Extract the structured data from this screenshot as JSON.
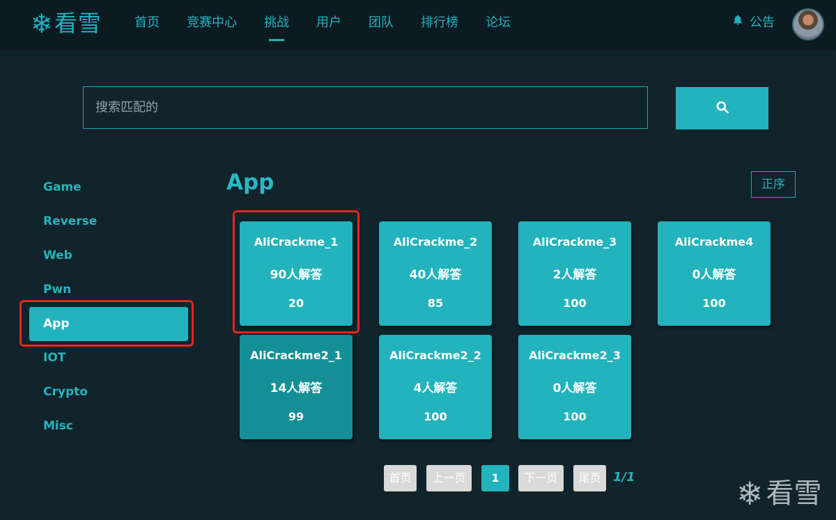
{
  "header": {
    "logo_icon": "snowflake-icon",
    "logo_glyph": "❄",
    "logo_text": "看雪",
    "nav": [
      {
        "label": "首页",
        "active": false
      },
      {
        "label": "竞赛中心",
        "active": false
      },
      {
        "label": "挑战",
        "active": true
      },
      {
        "label": "用户",
        "active": false
      },
      {
        "label": "团队",
        "active": false
      },
      {
        "label": "排行榜",
        "active": false
      },
      {
        "label": "论坛",
        "active": false
      }
    ],
    "notice_icon": "bell-icon",
    "notice_label": "公告"
  },
  "search": {
    "placeholder": "搜索匹配的",
    "button_icon": "search-icon"
  },
  "sidebar": {
    "items": [
      {
        "label": "Game",
        "active": false
      },
      {
        "label": "Reverse",
        "active": false
      },
      {
        "label": "Web",
        "active": false
      },
      {
        "label": "Pwn",
        "active": false
      },
      {
        "label": "App",
        "active": true
      },
      {
        "label": "IOT",
        "active": false
      },
      {
        "label": "Crypto",
        "active": false
      },
      {
        "label": "Misc",
        "active": false
      }
    ]
  },
  "main": {
    "category_title": "App",
    "sort_label": "正序",
    "cards": [
      {
        "name": "AliCrackme_1",
        "solved": "90人解答",
        "score": "20"
      },
      {
        "name": "AliCrackme_2",
        "solved": "40人解答",
        "score": "85"
      },
      {
        "name": "AliCrackme_3",
        "solved": "2人解答",
        "score": "100"
      },
      {
        "name": "AliCrackme4",
        "solved": "0人解答",
        "score": "100"
      },
      {
        "name": "AliCrackme2_1",
        "solved": "14人解答",
        "score": "99"
      },
      {
        "name": "AliCrackme2_2",
        "solved": "4人解答",
        "score": "100"
      },
      {
        "name": "AliCrackme2_3",
        "solved": "0人解答",
        "score": "100"
      }
    ]
  },
  "pagination": {
    "first": "首页",
    "prev": "上一页",
    "current": "1",
    "next": "下一页",
    "last": "尾页",
    "info": "1/1"
  },
  "watermark": {
    "glyph": "❄",
    "text": "看雪"
  },
  "colors": {
    "accent": "#22b3bc",
    "background": "#11232b",
    "header": "#0c1b22",
    "highlight_box": "#e5261b",
    "card_hover": "#158f96"
  }
}
